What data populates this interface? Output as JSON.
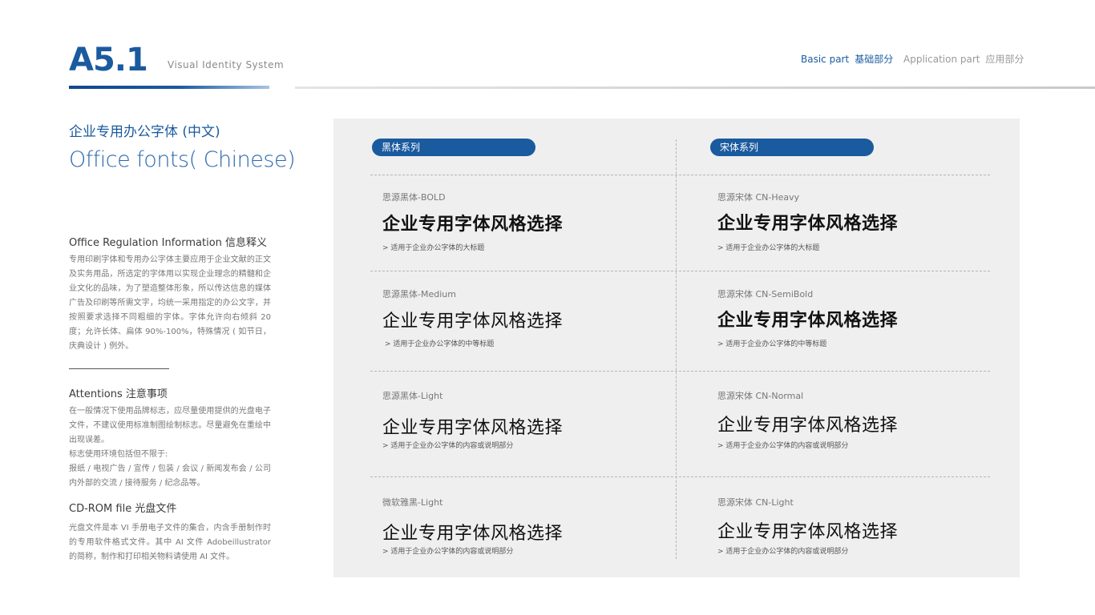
{
  "header": {
    "code": "A5.1",
    "subtitle": "Visual Identity System",
    "nav": {
      "basic_en": "Basic part",
      "basic_cn": "基础部分",
      "app_en": "Application part",
      "app_cn": "应用部分"
    }
  },
  "left": {
    "title_cn": "企业专用办公字体 (中文)",
    "title_en": "Office fonts( Chinese)",
    "sections": [
      {
        "heading": "Office Regulation Information 信息释义",
        "body": "专用印刷字体和专用办公字体主要应用于企业文献的正文及实务用品，所选定的字体用以实现企业理念的精髓和企业文化的品味，为了塑造整体形象，所以传达信息的媒体广告及印刷等所需文字，均统一采用指定的办公文字，并按照要求选择不同粗细的字体。字体允许向右倾斜 20 度；允许长体、扁体 90%-100%，特殊情况 ( 如节日，庆典设计 ) 例外。"
      },
      {
        "heading": "Attentions 注意事项",
        "body_lines": [
          "在一般情况下使用品牌标志，应尽量使用提供的光盘电子文件，不建议使用标准制图绘制标志。尽量避免在重绘中出现误差。",
          "标志使用环境包括但不限于:",
          "报纸 / 电视广告 / 宣传 / 包装 / 会议 / 新闻发布会 / 公司内外部的交流 / 接待服务 / 纪念品等。"
        ]
      },
      {
        "heading": "CD-ROM file 光盘文件",
        "body": "光盘文件是本 VI 手册电子文件的集合，内含手册制作时的专用软件格式文件。其中 AI 文件 Adobeillustrator 的简称，制作和打印相关物料请使用 AI 文件。"
      }
    ]
  },
  "panel": {
    "sample_text": "企业专用字体风格选择",
    "columns": [
      {
        "tag": "黑体系列",
        "fonts": [
          {
            "name": "思源黑体-BOLD",
            "usage": "> 适用于企业办公字体的大标题"
          },
          {
            "name": "思源黑体-Medium",
            "usage": "> 适用于企业办公字体的中等标题"
          },
          {
            "name": "思源黑体-Light",
            "usage": "> 适用于企业办公字体的内容或说明部分"
          },
          {
            "name": "微软雅黑-Light",
            "usage": "> 适用于企业办公字体的内容或说明部分"
          }
        ]
      },
      {
        "tag": "宋体系列",
        "fonts": [
          {
            "name": "思源宋体 CN-Heavy",
            "usage": "> 适用于企业办公字体的大标题"
          },
          {
            "name": "思源宋体 CN-SemiBold",
            "usage": "> 适用于企业办公字体的中等标题"
          },
          {
            "name": "思源宋体 CN-Normal",
            "usage": "> 适用于企业办公字体的内容或说明部分"
          },
          {
            "name": "思源宋体 CN-Light",
            "usage": "> 适用于企业办公字体的内容或说明部分"
          }
        ]
      }
    ]
  },
  "colors": {
    "brand_blue": "#1a5a9e",
    "panel_bg": "#efefef"
  }
}
